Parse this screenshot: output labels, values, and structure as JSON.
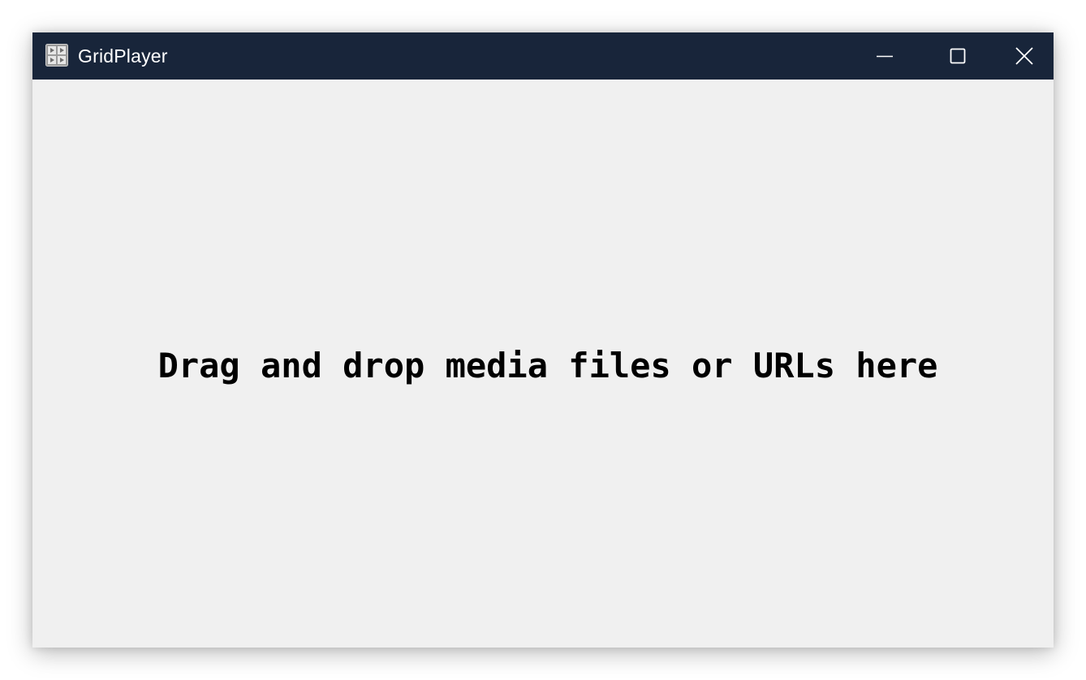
{
  "window": {
    "title": "GridPlayer",
    "titlebar_color": "#18253a",
    "app_icon": "grid-player-icon",
    "controls": {
      "minimize": "minimize-icon",
      "maximize": "maximize-icon",
      "close": "close-icon"
    }
  },
  "main": {
    "background_color": "#f0f0f0",
    "drop_hint": "Drag and drop media files or URLs here"
  }
}
